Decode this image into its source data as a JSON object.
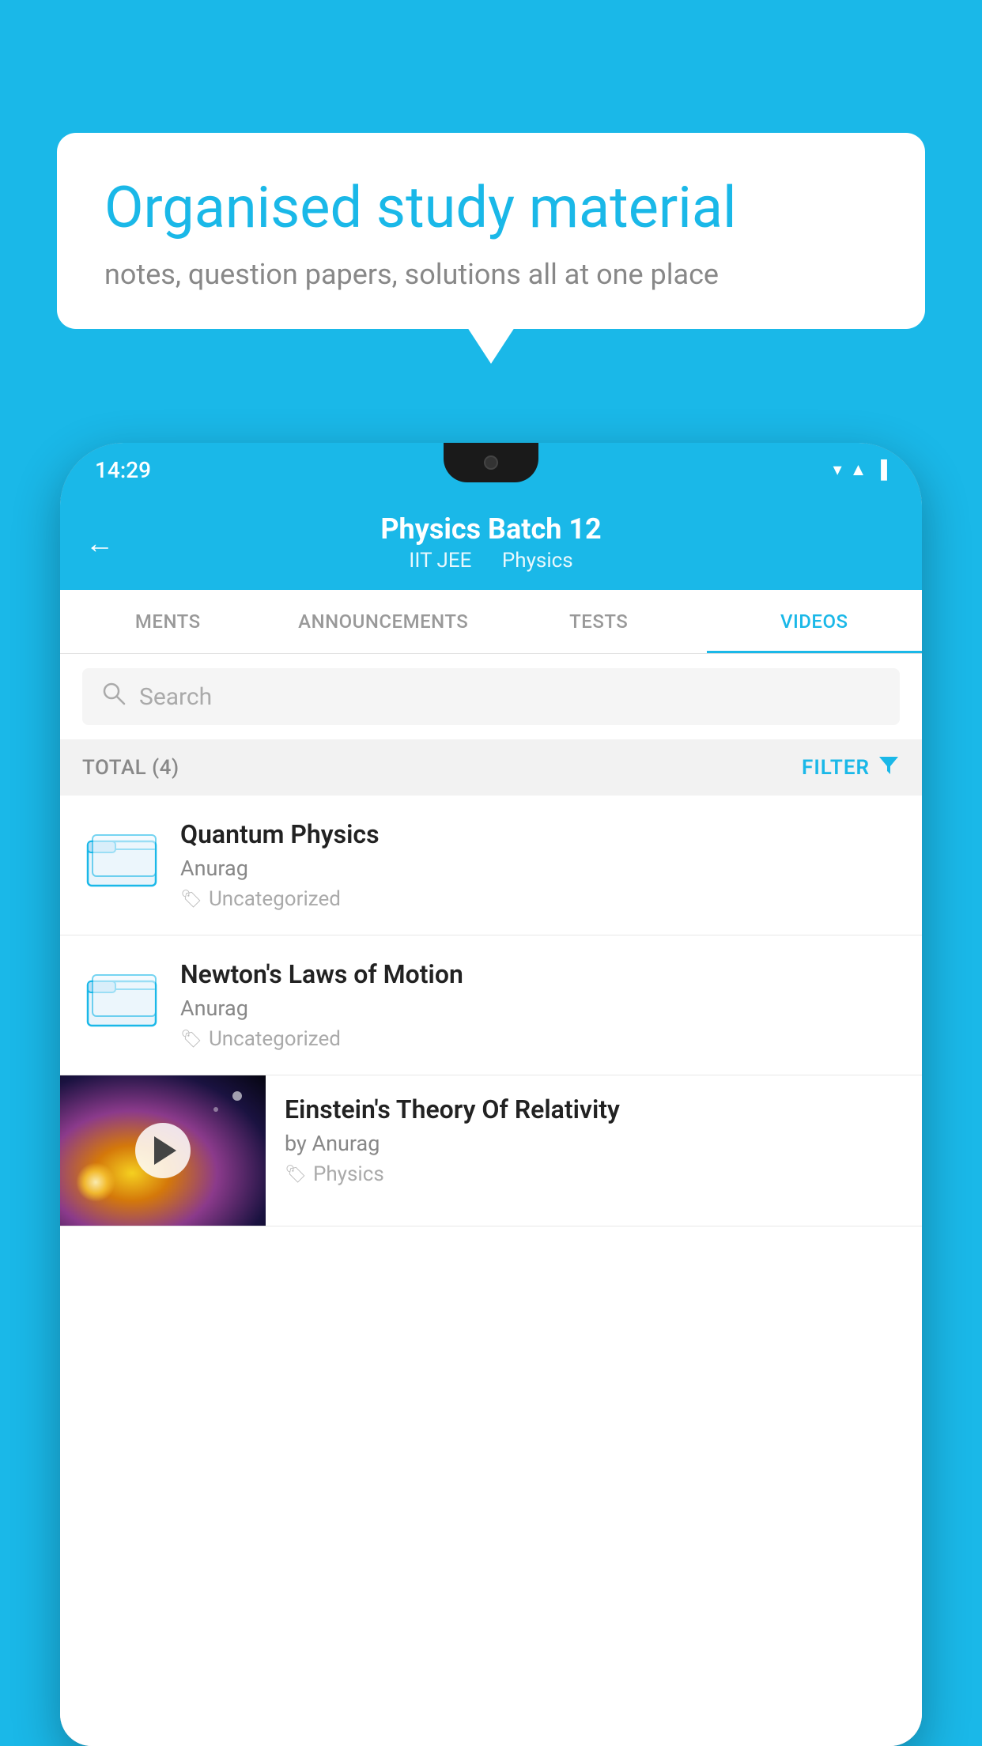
{
  "background_color": "#1ab8e8",
  "speech_bubble": {
    "title": "Organised study material",
    "subtitle": "notes, question papers, solutions all at one place"
  },
  "phone": {
    "status_bar": {
      "time": "14:29",
      "icons": [
        "▼",
        "◀",
        "▐"
      ]
    },
    "header": {
      "back_label": "←",
      "title": "Physics Batch 12",
      "subtitle_left": "IIT JEE",
      "subtitle_right": "Physics"
    },
    "tabs": [
      {
        "label": "MENTS",
        "active": false
      },
      {
        "label": "ANNOUNCEMENTS",
        "active": false
      },
      {
        "label": "TESTS",
        "active": false
      },
      {
        "label": "VIDEOS",
        "active": true
      }
    ],
    "search": {
      "placeholder": "Search"
    },
    "filter_bar": {
      "total_label": "TOTAL (4)",
      "filter_label": "FILTER"
    },
    "videos": [
      {
        "id": 1,
        "title": "Quantum Physics",
        "author": "Anurag",
        "tag": "Uncategorized",
        "has_thumb": false
      },
      {
        "id": 2,
        "title": "Newton's Laws of Motion",
        "author": "Anurag",
        "tag": "Uncategorized",
        "has_thumb": false
      },
      {
        "id": 3,
        "title": "Einstein's Theory Of Relativity",
        "author": "by Anurag",
        "tag": "Physics",
        "has_thumb": true
      }
    ]
  }
}
